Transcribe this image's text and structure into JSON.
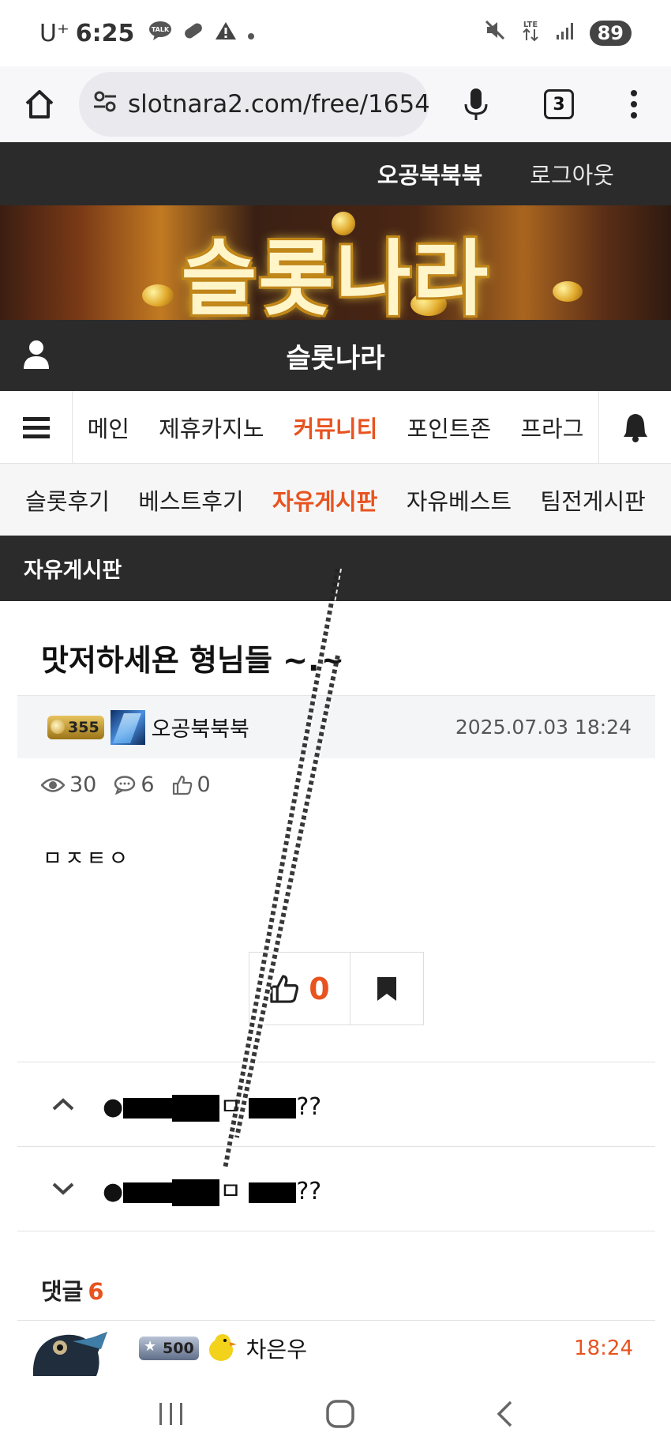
{
  "status_bar": {
    "carrier": "U⁺",
    "time": "6:25",
    "battery": "89"
  },
  "browser": {
    "url": "slotnara2.com/free/1654",
    "tab_count": "3"
  },
  "site": {
    "username": "오공북북북",
    "logout": "로그아웃",
    "banner_logo_text": "슬롯나라",
    "site_title": "슬롯나라"
  },
  "main_nav": {
    "items": [
      "메인",
      "제휴카지노",
      "커뮤니티",
      "포인트존",
      "프라그"
    ],
    "active": "커뮤니티"
  },
  "sub_nav": {
    "items": [
      "슬롯후기",
      "베스트후기",
      "자유게시판",
      "자유베스트",
      "팀전게시판"
    ],
    "active": "자유게시판"
  },
  "board": {
    "title": "자유게시판"
  },
  "post": {
    "title": "맛저하세욘 형님들 ~.~",
    "author_level": "355",
    "author": "오공북북북",
    "date": "2025.07.03 18:24",
    "views": "30",
    "comments": "6",
    "likes": "0",
    "body": "ㅁㅈㅌㅇ",
    "like_button_count": "0"
  },
  "prev_post": {
    "prefix": "●",
    "mid": "ㅁ",
    "suffix": "??"
  },
  "next_post": {
    "prefix": "●",
    "mid": "ㅁ",
    "suffix": "??"
  },
  "comments_section": {
    "label": "댓글",
    "count": "6",
    "first": {
      "level": "500",
      "author": "차은우",
      "time": "18:24"
    }
  },
  "colors": {
    "accent": "#e8531f",
    "dark_bar": "#2b2b2b"
  }
}
